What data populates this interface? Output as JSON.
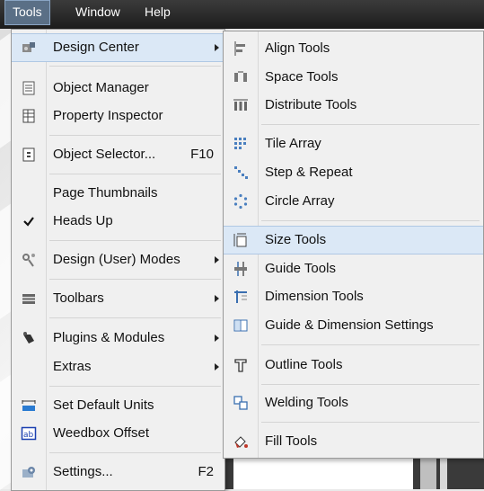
{
  "menubar": {
    "items": [
      {
        "label": "Tools"
      },
      {
        "label": "Window"
      },
      {
        "label": "Help"
      }
    ]
  },
  "tools_menu": {
    "items": [
      {
        "label": "Design Center",
        "icon": "design-center-icon",
        "submenu": true,
        "highlighted": true
      },
      {
        "label": "Object Manager",
        "icon": "object-manager-icon"
      },
      {
        "label": "Property Inspector",
        "icon": "property-inspector-icon"
      },
      {
        "label": "Object Selector...",
        "icon": "object-selector-icon",
        "shortcut": "F10"
      },
      {
        "label": "Page Thumbnails"
      },
      {
        "label": "Heads Up",
        "icon": "checkmark-icon",
        "checked": true
      },
      {
        "label": "Design (User) Modes",
        "icon": "design-modes-icon",
        "submenu": true
      },
      {
        "label": "Toolbars",
        "icon": "toolbars-icon",
        "submenu": true
      },
      {
        "label": "Plugins & Modules",
        "icon": "plugins-icon",
        "submenu": true
      },
      {
        "label": "Extras",
        "submenu": true
      },
      {
        "label": "Set Default Units",
        "icon": "units-ruler-icon"
      },
      {
        "label": "Weedbox Offset",
        "icon": "weedbox-icon"
      },
      {
        "label": "Settings...",
        "icon": "settings-icon",
        "shortcut": "F2"
      }
    ]
  },
  "design_center_submenu": {
    "items": [
      {
        "label": "Align Tools",
        "icon": "align-tools-icon"
      },
      {
        "label": "Space Tools",
        "icon": "space-tools-icon"
      },
      {
        "label": "Distribute Tools",
        "icon": "distribute-tools-icon"
      },
      {
        "label": "Tile Array",
        "icon": "tile-array-icon"
      },
      {
        "label": "Step & Repeat",
        "icon": "step-repeat-icon"
      },
      {
        "label": "Circle Array",
        "icon": "circle-array-icon"
      },
      {
        "label": "Size Tools",
        "icon": "size-tools-icon",
        "highlighted": true
      },
      {
        "label": "Guide Tools",
        "icon": "guide-tools-icon"
      },
      {
        "label": "Dimension Tools",
        "icon": "dimension-tools-icon"
      },
      {
        "label": "Guide & Dimension Settings",
        "icon": "guide-dimension-settings-icon"
      },
      {
        "label": "Outline Tools",
        "icon": "outline-tools-icon"
      },
      {
        "label": "Welding Tools",
        "icon": "welding-tools-icon"
      },
      {
        "label": "Fill Tools",
        "icon": "fill-tools-icon"
      }
    ]
  },
  "colors": {
    "menubar_bg": "#2a2a2a",
    "menu_bg": "#f0f0f0",
    "highlight": "#dbe8f6",
    "highlight_border": "#b0c8e4"
  }
}
